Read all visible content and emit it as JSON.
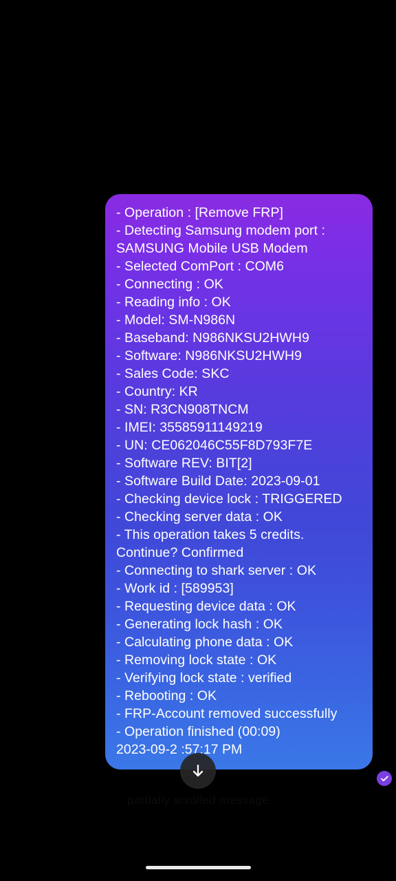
{
  "app": {
    "background_color": "#000000",
    "bubble_gradient_start": "#8a2be2",
    "bubble_gradient_mid": "#4048d8",
    "bubble_gradient_end": "#3b78e8",
    "text_color": "#ffffff"
  },
  "message": {
    "log_lines": [
      "- Operation : [Remove FRP]",
      "- Detecting Samsung modem port : SAMSUNG Mobile USB Modem",
      "- Selected ComPort : COM6",
      "- Connecting : OK",
      "- Reading info : OK",
      "- Model: SM-N986N",
      "- Baseband: N986NKSU2HWH9",
      "- Software: N986NKSU2HWH9",
      "- Sales Code: SKC",
      "- Country: KR",
      "- SN: R3CN908TNCM",
      "- IMEI: 35585911149219",
      "- UN: CE062046C55F8D793F7E",
      "- Software REV: BIT[2]",
      "- Software Build Date: 2023-09-01",
      "- Checking device lock : TRIGGERED",
      "- Checking server data : OK",
      "- This operation takes 5 credits. Continue? Confirmed",
      "- Connecting to shark server : OK",
      "- Work id : [589953]",
      "- Requesting device data : OK",
      "- Generating lock hash : OK",
      "- Calculating phone data : OK",
      "- Removing lock state : OK",
      "- Verifying lock state : verified",
      "- Rebooting : OK",
      "- FRP-Account removed successfully",
      "- Operation finished (00:09)"
    ],
    "timestamp": "2023-09-2  :57:17 PM",
    "status": "delivered"
  },
  "overlay": {
    "scroll_to_bottom_label": "scroll-to-bottom",
    "faint_preview_text": "partially scrolled message"
  },
  "navigation": {
    "gesture_pill": "home-gesture-pill"
  }
}
